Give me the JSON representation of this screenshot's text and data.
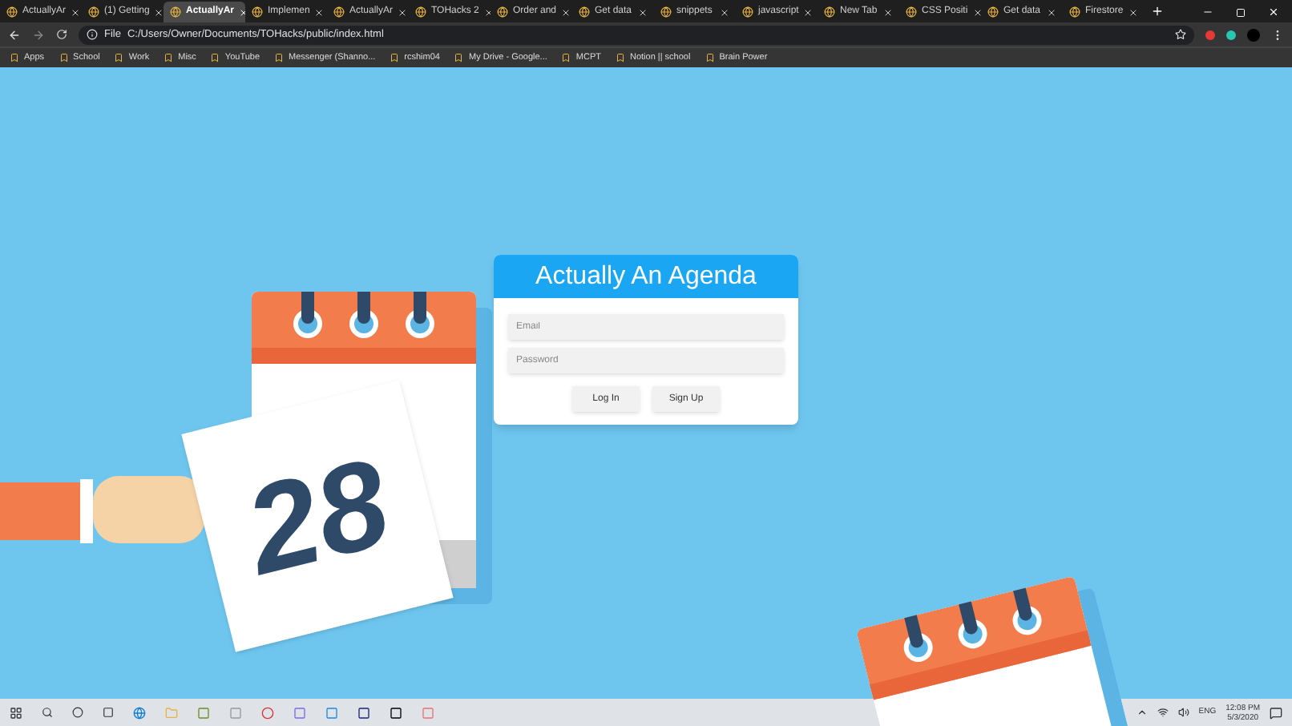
{
  "tabs": [
    {
      "title": "ActuallyAr",
      "selected": false
    },
    {
      "title": "(1) Getting",
      "selected": false
    },
    {
      "title": "ActuallyAr",
      "selected": true
    },
    {
      "title": "Implemen",
      "selected": false
    },
    {
      "title": "ActuallyAr",
      "selected": false
    },
    {
      "title": "TOHacks 2",
      "selected": false
    },
    {
      "title": "Order and",
      "selected": false
    },
    {
      "title": "Get data",
      "selected": false
    },
    {
      "title": "snippets",
      "selected": false
    },
    {
      "title": "javascript",
      "selected": false
    },
    {
      "title": "New Tab",
      "selected": false
    },
    {
      "title": "CSS Positi",
      "selected": false
    },
    {
      "title": "Get data",
      "selected": false
    },
    {
      "title": "Firestore",
      "selected": false
    }
  ],
  "address_bar": {
    "scheme": "File",
    "url": "C:/Users/Owner/Documents/TOHacks/public/index.html"
  },
  "bookmarks": [
    "Apps",
    "School",
    "Work",
    "Misc",
    "YouTube",
    "Messenger (Shanno...",
    "rcshim04",
    "My Drive - Google...",
    "MCPT",
    "Notion || school",
    "Brain Power"
  ],
  "illustration": {
    "day": "28"
  },
  "login_card": {
    "title": "Actually An Agenda",
    "email": {
      "placeholder": "Email"
    },
    "password": {
      "placeholder": "Password"
    },
    "buttons": [
      "Log In",
      "Sign Up"
    ]
  },
  "taskbar": {
    "language": "ENG",
    "time": "12:08 PM",
    "date": "5/3/2020"
  }
}
